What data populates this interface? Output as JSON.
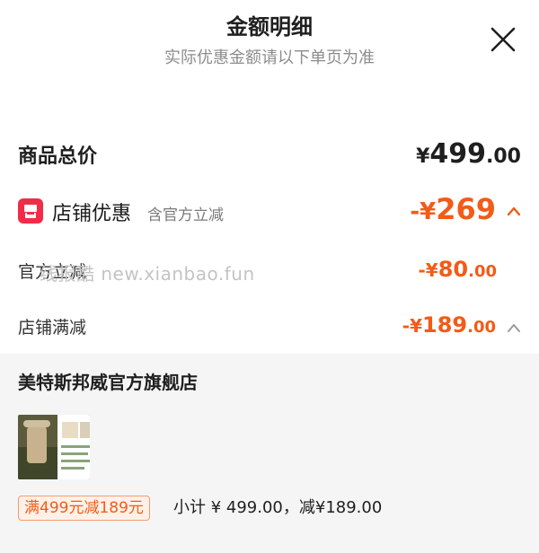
{
  "header": {
    "title": "金额明细",
    "subtitle": "实际优惠金额请以下单页为准"
  },
  "total": {
    "label": "商品总价",
    "symbol": "¥",
    "integer": "499",
    "decimal": ".00"
  },
  "store_discount": {
    "label": "店铺优惠",
    "note": "含官方立减",
    "prefix": "-¥",
    "integer": "269",
    "expanded": true
  },
  "official_discount": {
    "label": "官方立减",
    "prefix": "-¥",
    "integer": "80",
    "decimal": ".00"
  },
  "full_discount": {
    "label": "店铺满减",
    "prefix": "-¥",
    "integer": "189",
    "decimal": ".00",
    "expanded": true
  },
  "watermark": "线报酷 new.xianbao.fun",
  "shop": {
    "name": "美特斯邦威官方旗舰店",
    "tag": "满499元减189元",
    "subtotal": "小计 ¥ 499.00，减¥189.00"
  },
  "colors": {
    "accent": "#f25b18",
    "store_icon": "#f02d48",
    "panel_bg": "#f5f5f5"
  }
}
